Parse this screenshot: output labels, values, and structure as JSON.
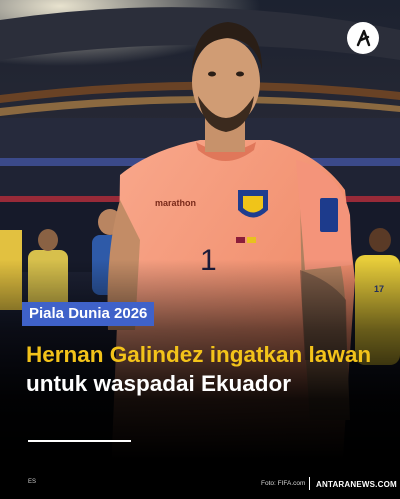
{
  "article": {
    "category": "Piala Dunia 2026",
    "headline_accent": "Hernan Galindez ingatkan lawan",
    "headline_rest": " untuk waspadai Ekuador"
  },
  "photo": {
    "jersey_brand": "marathon",
    "jersey_number": "1",
    "sleeve_number": "17"
  },
  "footer": {
    "initials": "ES",
    "photo_credit": "Foto: FIFA.com",
    "site": "ANTARANEWS.COM"
  },
  "icons": {
    "logo": "antara-logo-icon"
  },
  "colors": {
    "category_bg": "#3f62c9",
    "headline_accent": "#f3c31a",
    "headline_text": "#ffffff",
    "jersey": "#f79e84"
  }
}
